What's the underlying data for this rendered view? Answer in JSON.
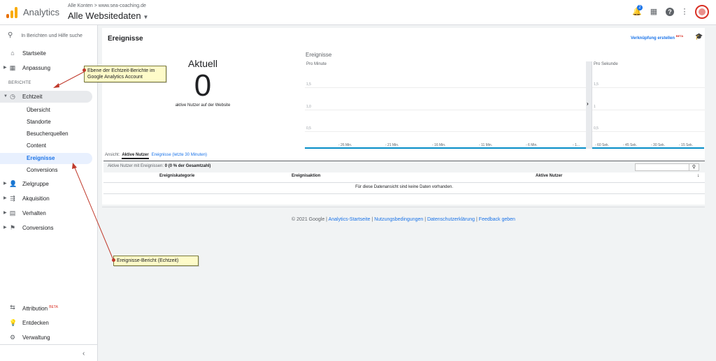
{
  "header": {
    "app_name": "Analytics",
    "breadcrumb": "Alle Konten > www.sea-coaching.de",
    "property": "Alle Websitedaten",
    "notification_count": "2"
  },
  "sidebar": {
    "search_placeholder": "In Berichten und Hilfe suche",
    "items_top": [
      {
        "label": "Startseite"
      },
      {
        "label": "Anpassung"
      }
    ],
    "section_label": "BERICHTE",
    "realtime": {
      "label": "Echtzeit"
    },
    "realtime_sub": [
      {
        "label": "Übersicht"
      },
      {
        "label": "Standorte"
      },
      {
        "label": "Besucherquellen"
      },
      {
        "label": "Content"
      },
      {
        "label": "Ereignisse"
      },
      {
        "label": "Conversions"
      }
    ],
    "items_bottom": [
      {
        "label": "Zielgruppe"
      },
      {
        "label": "Akquisition"
      },
      {
        "label": "Verhalten"
      },
      {
        "label": "Conversions"
      }
    ],
    "footer_items": [
      {
        "label": "Attribution",
        "badge": "BETA"
      },
      {
        "label": "Entdecken"
      },
      {
        "label": "Verwaltung"
      }
    ]
  },
  "main": {
    "title": "Ereignisse",
    "create_link": "Verknüpfung erstellen",
    "create_badge": "BETA",
    "current_label": "Aktuell",
    "current_value": "0",
    "current_sub": "aktive Nutzer auf der Website",
    "chart_title": "Ereignisse",
    "per_minute_label": "Pro Minute",
    "per_second_label": "Pro Sekunde",
    "view_label": "Ansicht:",
    "view_active": "Aktive Nutzer",
    "view_link": "Ereignisse (letzte 30 Minuten)",
    "table_info_prefix": "Aktive Nutzer mit Ereignissen:",
    "table_info_value": "0 (0 % der Gesamtzahl)",
    "columns": [
      "Ereigniskategorie",
      "Ereignisaktion",
      "Aktive Nutzer"
    ],
    "empty_message": "Für diese Datenansicht sind keine Daten vorhanden."
  },
  "footer": {
    "copyright": "© 2021 Google |",
    "links": [
      "Analytics-Startseite",
      "Nutzungsbedingungen",
      "Datenschutzerklärung",
      "Feedback geben"
    ]
  },
  "annotations": {
    "callout1": "Ebene der Echtzeit-Berichte im Google Analytics Account",
    "callout2": "Ereignisse-Bericht (Echtzeit)"
  },
  "chart_data": [
    {
      "type": "line",
      "title": "Pro Minute",
      "x": [
        "- 26 Min.",
        "- 21 Min.",
        "- 16 Min.",
        "- 11 Min.",
        "- 6 Min.",
        "- 1..."
      ],
      "yticks": [
        "1,5",
        "1,0",
        "0,5"
      ],
      "series": [
        {
          "values": [
            0,
            0,
            0,
            0,
            0,
            0
          ]
        }
      ]
    },
    {
      "type": "line",
      "title": "Pro Sekunde",
      "x": [
        "- 60 Sek.",
        "- 45 Sek.",
        "- 30 Sek.",
        "- 15 Sek."
      ],
      "yticks": [
        "1,5",
        "1",
        "0,5"
      ],
      "series": [
        {
          "values": [
            0,
            0,
            0,
            0
          ]
        }
      ]
    }
  ]
}
